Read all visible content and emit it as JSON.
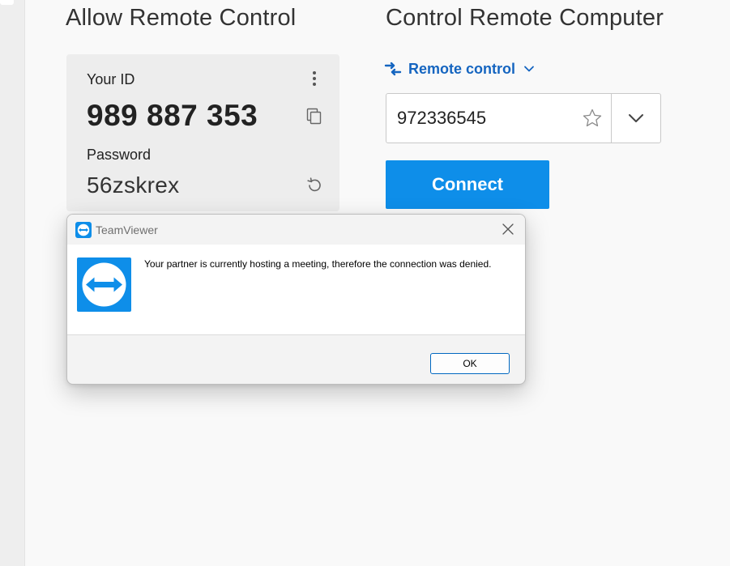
{
  "left_panel": {
    "title": "Allow Remote Control",
    "id_label": "Your ID",
    "id_value": "989 887 353",
    "password_label": "Password",
    "password_value": "56zskrex"
  },
  "right_panel": {
    "title": "Control Remote Computer",
    "mode_label": "Remote control",
    "partner_id_value": "972336545",
    "connect_label": "Connect"
  },
  "dialog": {
    "title": "TeamViewer",
    "message": "Your partner is currently hosting a meeting, therefore the connection was denied.",
    "ok_label": "OK"
  },
  "colors": {
    "accent_blue": "#0e8ee9",
    "link_blue": "#1565c0",
    "logo_blue": "#0e8ee9"
  },
  "icons": {
    "more": "kebab-icon",
    "copy": "copy-icon",
    "refresh": "refresh-icon",
    "swap": "swap-arrows-icon",
    "favorite": "star-icon",
    "dropdown": "chevron-down-icon",
    "close": "close-icon",
    "logo": "teamviewer-logo"
  }
}
